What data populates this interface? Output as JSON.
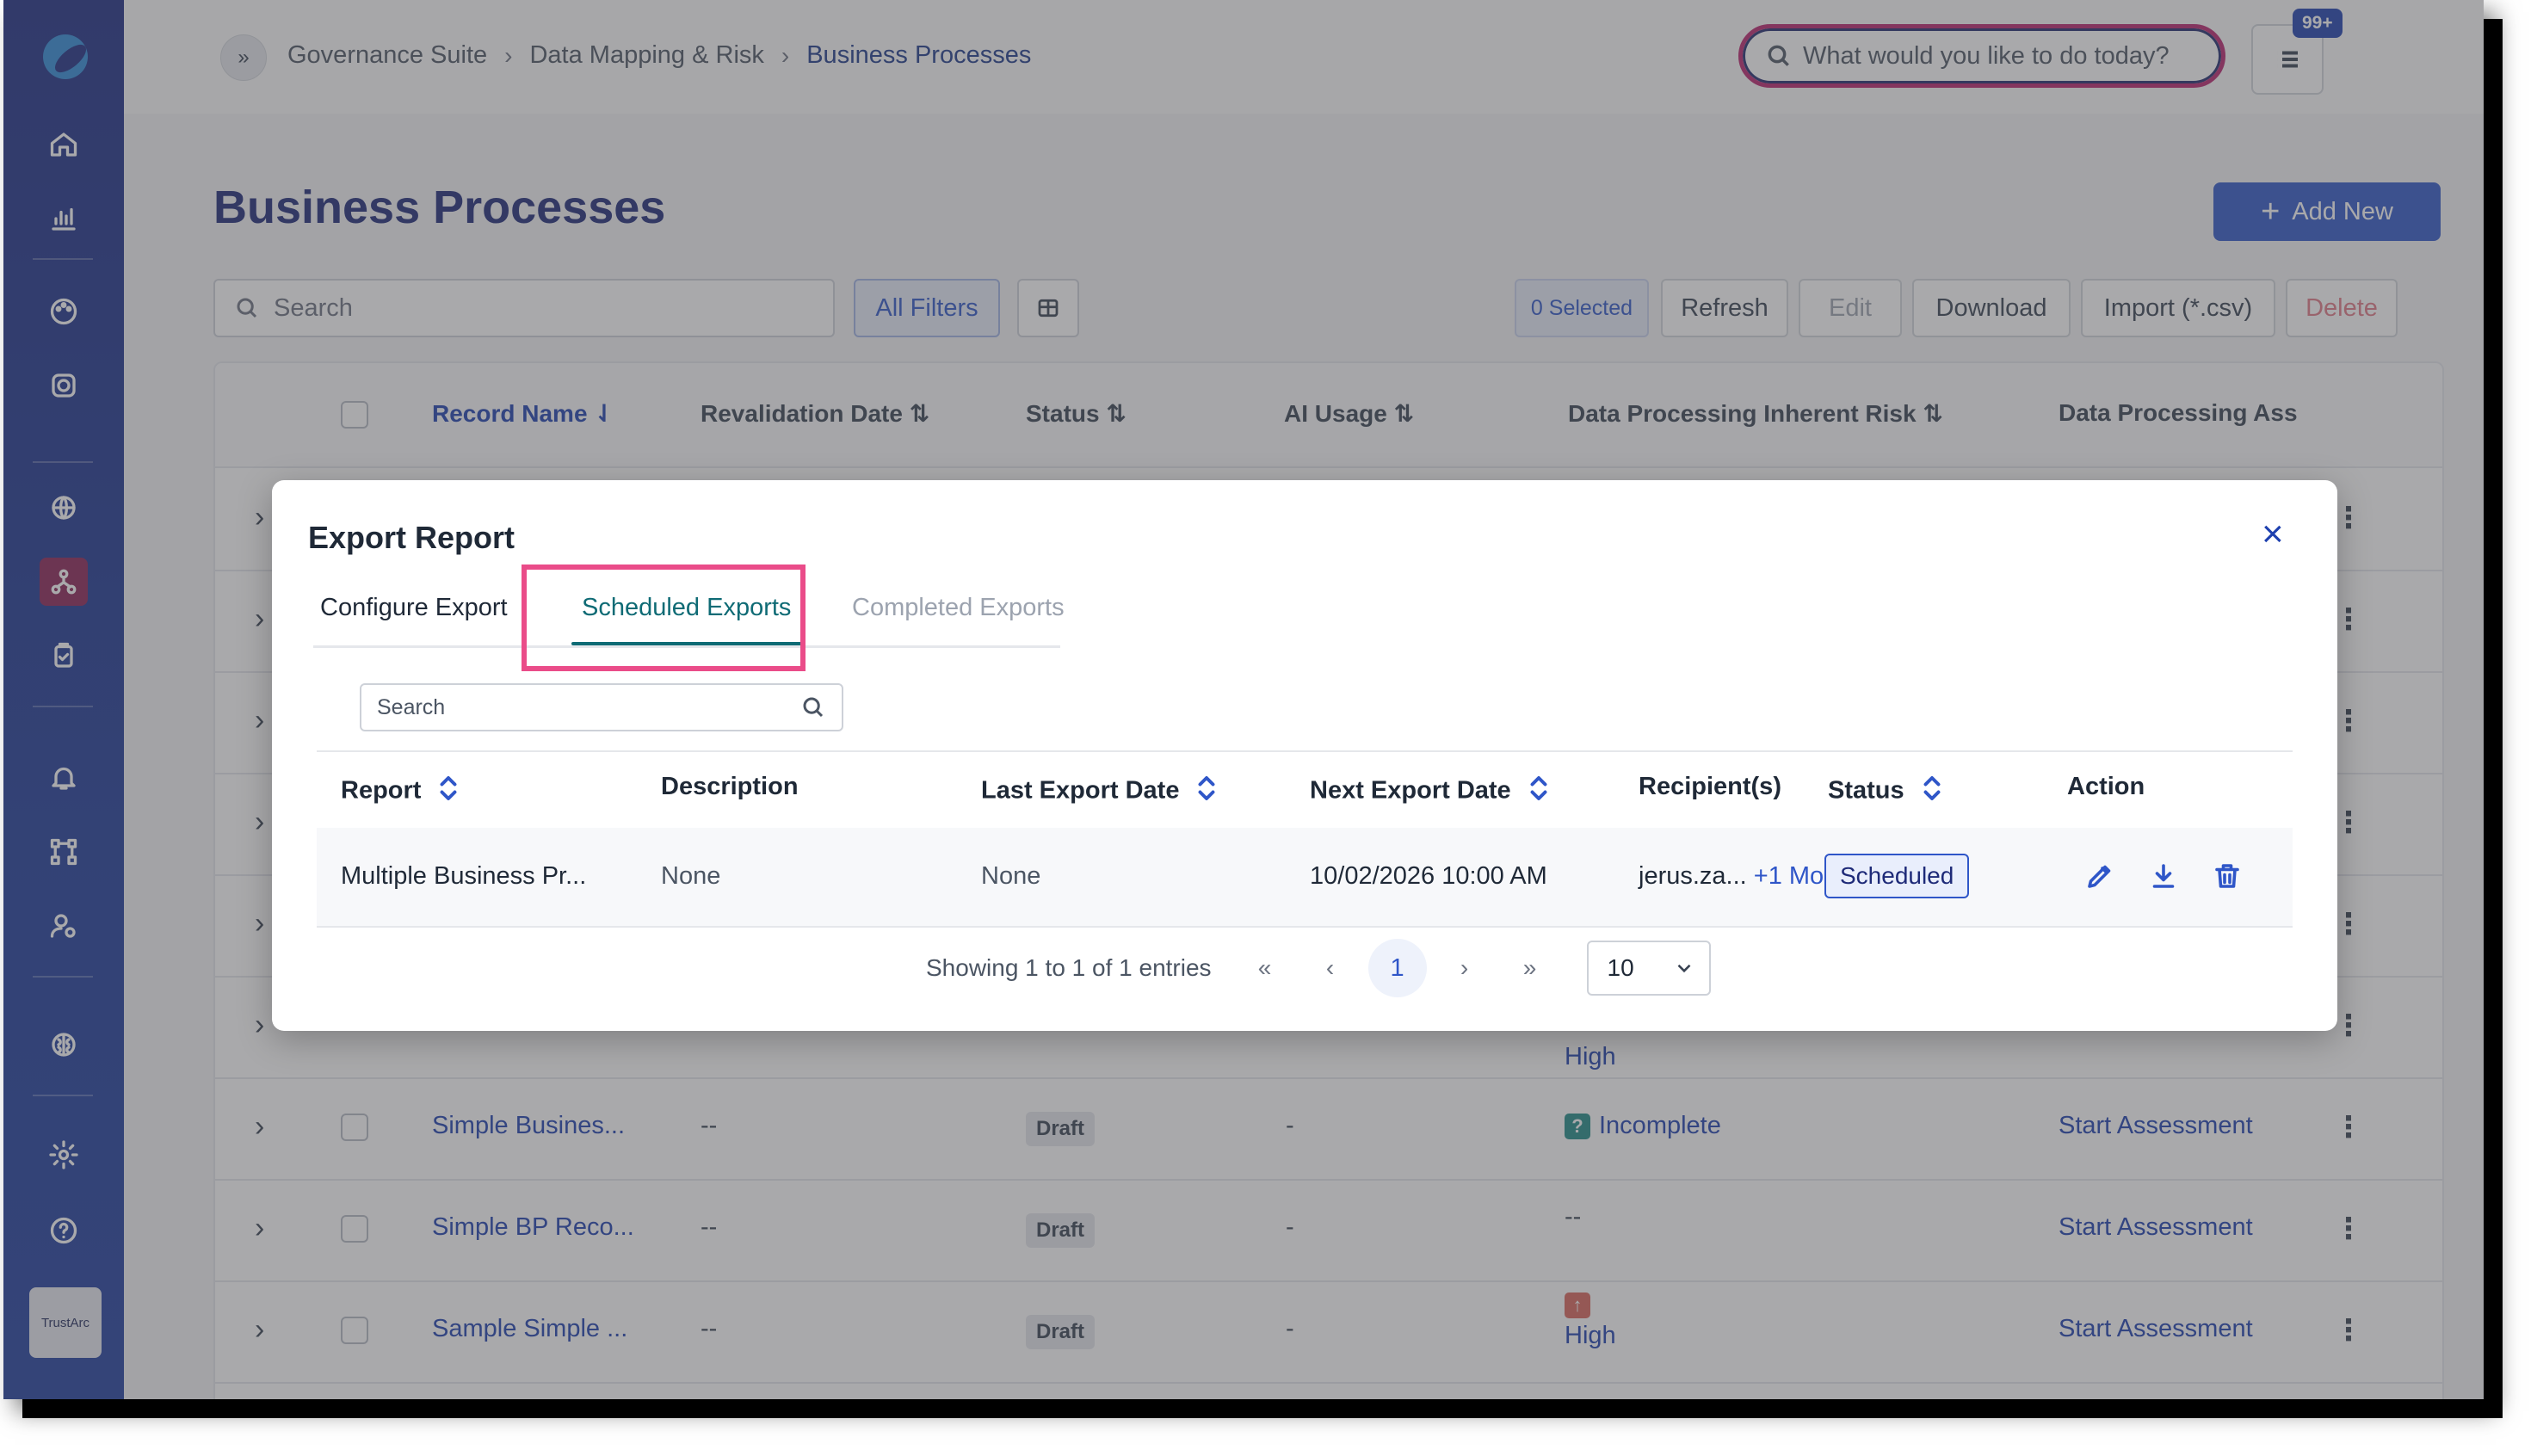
{
  "app": {
    "brand_label": "TrustArc"
  },
  "breadcrumb": [
    "Governance Suite",
    "Data Mapping & Risk",
    "Business Processes"
  ],
  "global_search": {
    "placeholder": "What would you like to do today?"
  },
  "notifications": {
    "badge": "99+"
  },
  "page": {
    "title": "Business Processes",
    "add_new": "Add New"
  },
  "toolbar": {
    "search_placeholder": "Search",
    "all_filters": "All Filters",
    "selected": "0 Selected",
    "refresh": "Refresh",
    "edit": "Edit",
    "download": "Download",
    "import": "Import (*.csv)",
    "delete": "Delete"
  },
  "grid": {
    "columns": [
      "Record Name",
      "Revalidation Date",
      "Status",
      "AI Usage",
      "Data Processing Inherent Risk",
      "Data Processing Ass"
    ],
    "rows": [
      {
        "name": "",
        "revalidation": "",
        "status": "",
        "ai": "",
        "risk": "High",
        "action": ""
      },
      {
        "name": "Simple Busines...",
        "revalidation": "--",
        "status": "Draft",
        "ai": "-",
        "risk": "Incomplete",
        "action": "Start Assessment"
      },
      {
        "name": "Simple BP Reco...",
        "revalidation": "--",
        "status": "Draft",
        "ai": "-",
        "risk": "--",
        "action": "Start Assessment"
      },
      {
        "name": "Sample Simple ...",
        "revalidation": "--",
        "status": "Draft",
        "ai": "-",
        "risk": "High",
        "action": "Start Assessment"
      }
    ]
  },
  "modal": {
    "title": "Export Report",
    "close_label": "×",
    "tabs": [
      "Configure Export",
      "Scheduled Exports",
      "Completed Exports"
    ],
    "active_tab": "Scheduled Exports",
    "search_placeholder": "Search",
    "columns": [
      "Report",
      "Description",
      "Last Export Date",
      "Next Export Date",
      "Recipient(s)",
      "Status",
      "Action"
    ],
    "rows": [
      {
        "report": "Multiple Business Pr...",
        "description": "None",
        "last_export": "None",
        "next_export": "10/02/2026 10:00 AM",
        "recipient": "jerus.za...",
        "recipient_more": "+1 More",
        "status": "Scheduled"
      }
    ],
    "pagination": {
      "summary": "Showing 1 to 1 of 1 entries",
      "first": "«",
      "prev": "‹",
      "current": "1",
      "next": "›",
      "last": "»",
      "page_size": "10"
    }
  },
  "colors": {
    "sidebar": "#1b2b83",
    "accent": "#2f56c8",
    "active_tab": "#0f6b75",
    "highlight": "#ea4c89",
    "search_ring": "#b8246d"
  },
  "icons": [
    "home-icon",
    "chart-icon",
    "palette-icon",
    "target-icon",
    "globe-icon",
    "network-icon",
    "clipboard-icon",
    "bell-icon",
    "workflow-icon",
    "user-settings-icon",
    "brain-icon",
    "gear-icon",
    "help-icon",
    "search-icon",
    "list-icon",
    "columns-icon",
    "edit-icon",
    "download-icon",
    "trash-icon",
    "sort-icon"
  ]
}
